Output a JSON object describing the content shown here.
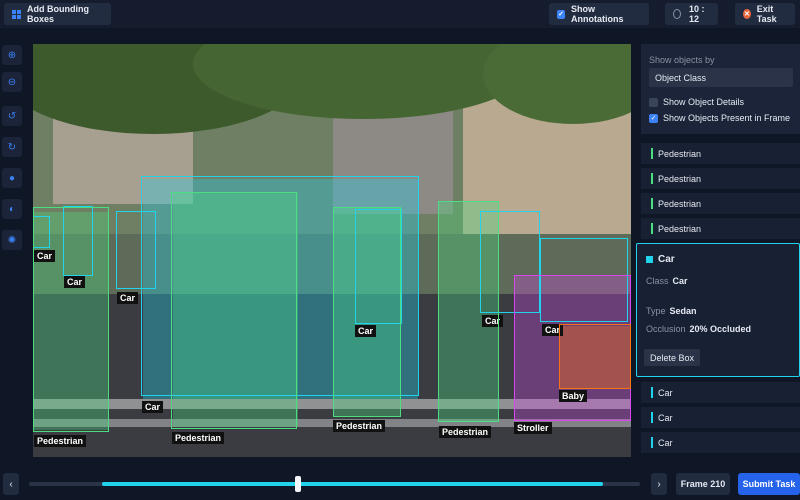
{
  "header": {
    "title": "Add Bounding Boxes",
    "show_annotations": "Show Annotations",
    "timer": "10 : 12",
    "exit": "Exit Task"
  },
  "tool_icons": [
    "zoom-in-icon",
    "zoom-out-icon",
    "undo-icon",
    "redo-icon",
    "brightness-icon",
    "contrast-icon",
    "settings-icon"
  ],
  "annotations": [
    {
      "label": "Car",
      "color": "#22d3ee"
    },
    {
      "label": "Car",
      "color": "#22d3ee"
    },
    {
      "label": "Car",
      "color": "#22d3ee"
    },
    {
      "label": "Car",
      "color": "#22d3ee"
    },
    {
      "label": "Car",
      "color": "#22d3ee"
    },
    {
      "label": "Car",
      "color": "#22d3ee"
    },
    {
      "label": "Car",
      "color": "#22d3ee"
    },
    {
      "label": "Pedestrian",
      "color": "#4ade80"
    },
    {
      "label": "Pedestrian",
      "color": "#4ade80"
    },
    {
      "label": "Pedestrian",
      "color": "#4ade80"
    },
    {
      "label": "Pedestrian",
      "color": "#4ade80"
    },
    {
      "label": "Stroller",
      "color": "#d946ef"
    },
    {
      "label": "Baby",
      "color": "#f97316"
    }
  ],
  "panel": {
    "show_by_label": "Show objects by",
    "select_value": "Object Class",
    "opt1": "Show Object Details",
    "opt2": "Show Objects Present in Frame"
  },
  "list_top": [
    {
      "label": "Pedestrian",
      "color": "#4ade80"
    },
    {
      "label": "Pedestrian",
      "color": "#4ade80"
    },
    {
      "label": "Pedestrian",
      "color": "#4ade80"
    },
    {
      "label": "Pedestrian",
      "color": "#4ade80"
    }
  ],
  "detail": {
    "title": "Car",
    "class_key": "Class",
    "class_val": "Car",
    "type_key": "Type",
    "type_val": "Sedan",
    "occ_key": "Occlusion",
    "occ_val": "20% Occluded",
    "delete": "Delete Box"
  },
  "list_bottom": [
    {
      "label": "Car",
      "color": "#22d3ee"
    },
    {
      "label": "Car",
      "color": "#22d3ee"
    },
    {
      "label": "Car",
      "color": "#22d3ee"
    }
  ],
  "timeline": {
    "progress": 0.44,
    "buffered_start": 0.12,
    "buffered_end": 0.94
  },
  "frame": "Frame 210",
  "submit": "Submit Task"
}
